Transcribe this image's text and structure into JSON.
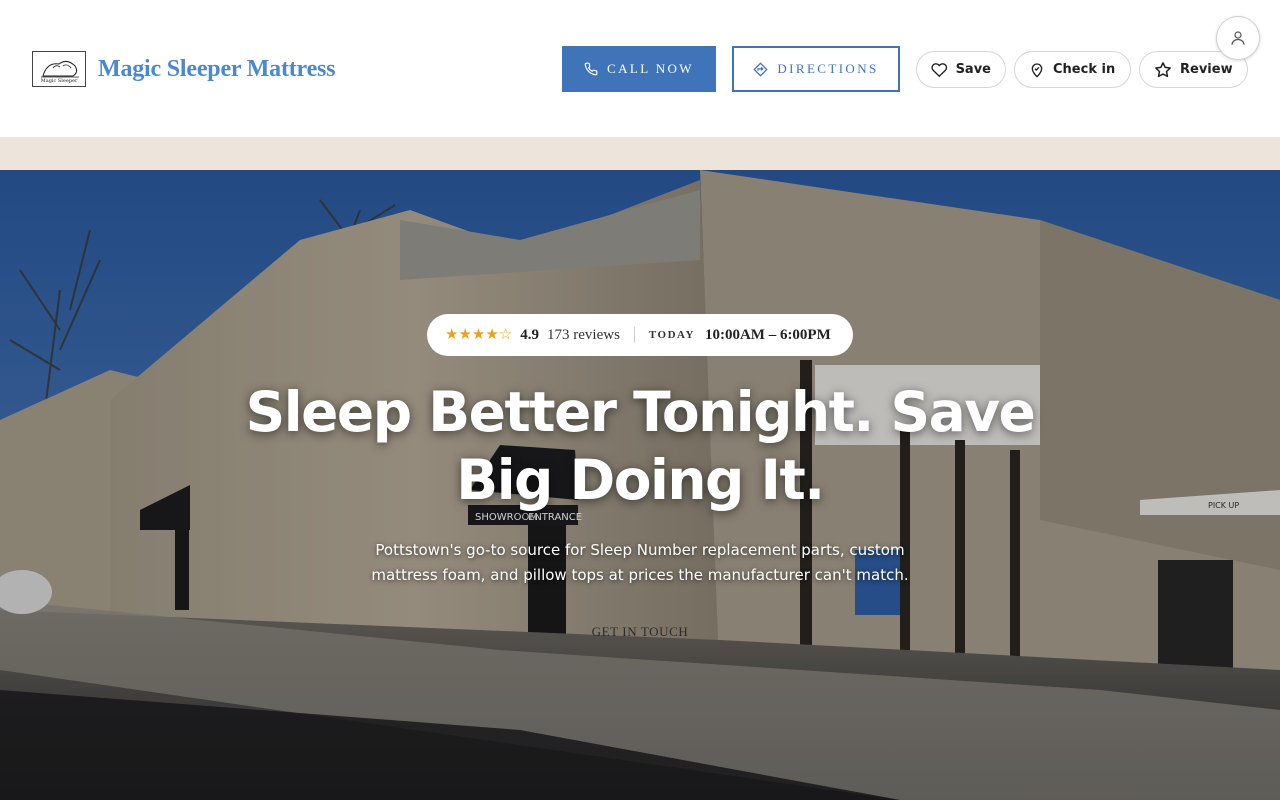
{
  "brand": {
    "name": "Magic Sleeper Mattress",
    "logo_text": "Magic Sleeper"
  },
  "header": {
    "call_label": "CALL NOW",
    "directions_label": "DIRECTIONS",
    "save_label": "Save",
    "checkin_label": "Check in",
    "review_label": "Review"
  },
  "hero": {
    "rating": "4.9",
    "rating_value": 4.9,
    "rating_max": 5,
    "reviews": "173 reviews",
    "today_label": "TODAY",
    "hours": "10:00AM – 6:00PM",
    "headline": "Sleep Better Tonight. Save Big Doing It.",
    "subtext": "Pottstown's go-to source for Sleep Number replacement parts, custom mattress foam, and pillow tops at prices the manufacturer can't match.",
    "cta_label": "GET IN TOUCH",
    "photo_signs": {
      "showroom": "SHOWROOM",
      "entrance": "ENTRANCE",
      "pickup": "PICK UP"
    }
  },
  "icons": {
    "call": "phone-icon",
    "directions": "directions-icon",
    "save": "heart-icon",
    "checkin": "location-pin-icon",
    "review": "star-icon",
    "account": "user-icon"
  },
  "colors": {
    "accent": "#3f74b9",
    "brand_text": "#4a88cf",
    "band": "#ede5dc",
    "star": "#e8a21e"
  }
}
